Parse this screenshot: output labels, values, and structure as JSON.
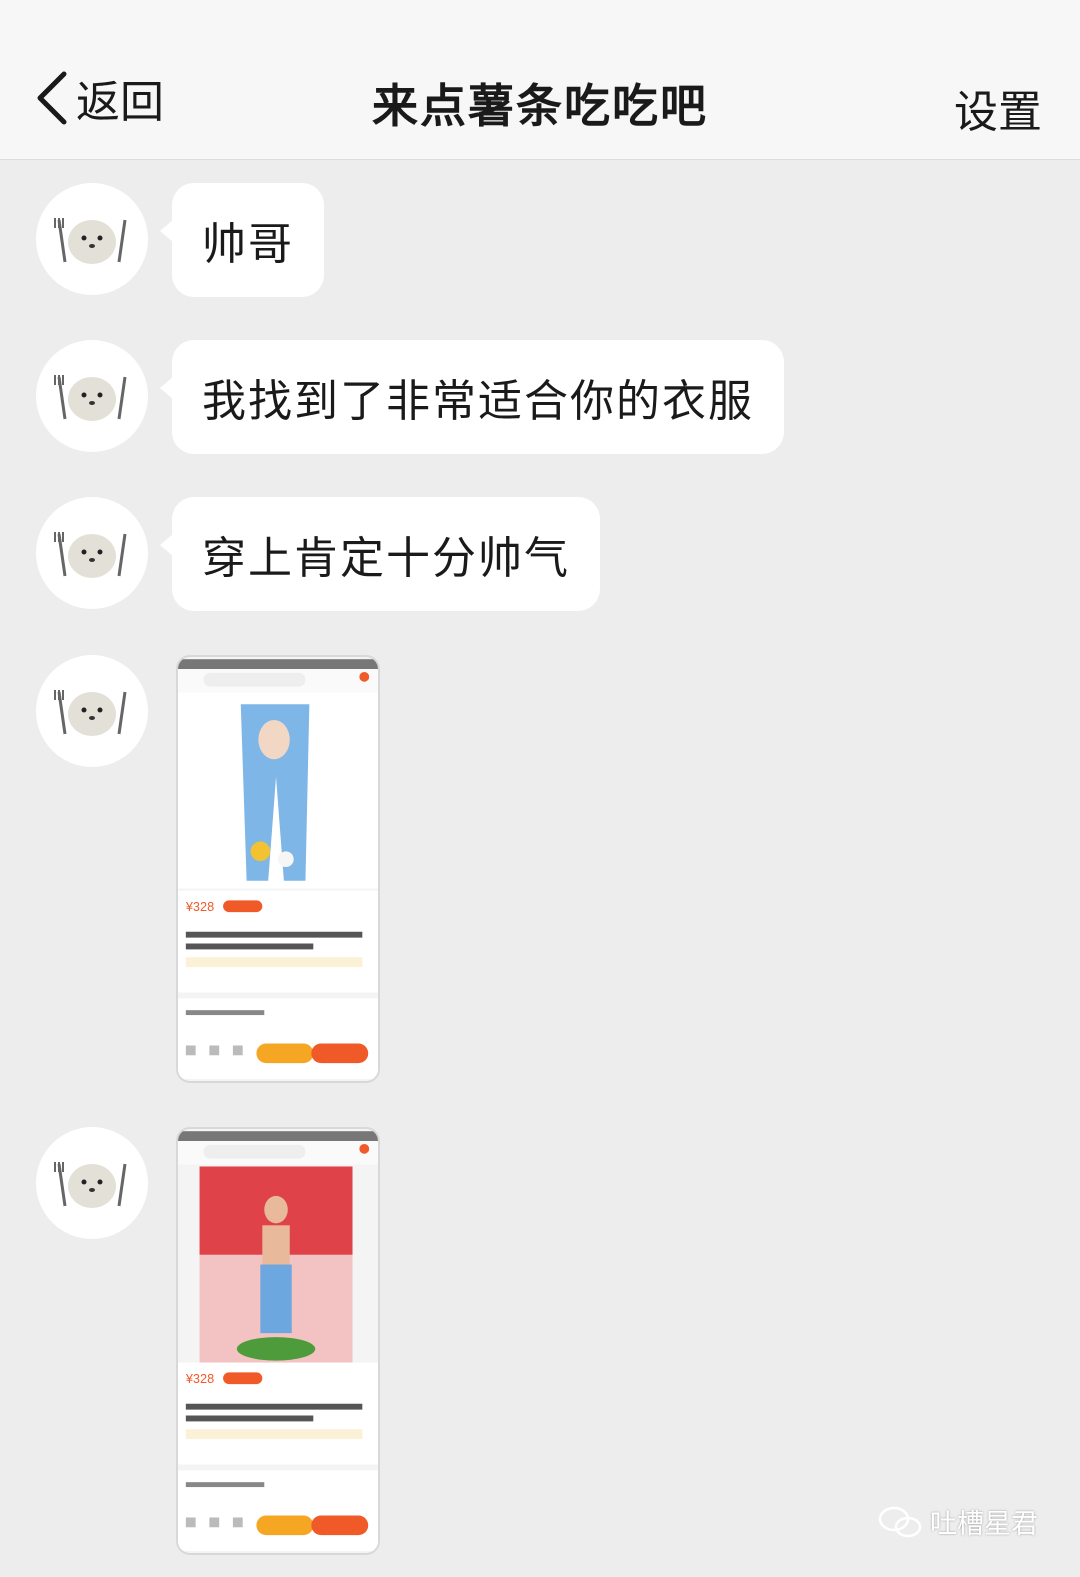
{
  "header": {
    "back_label": "返回",
    "title": "来点薯条吃吃吧",
    "settings_label": "设置"
  },
  "messages": [
    {
      "type": "text",
      "text": "帅哥"
    },
    {
      "type": "text",
      "text": "我找到了非常适合你的衣服"
    },
    {
      "type": "text",
      "text": "穿上肯定十分帅气"
    },
    {
      "type": "image",
      "product_price": "¥328"
    },
    {
      "type": "image",
      "product_price": "¥328"
    }
  ],
  "watermark": {
    "text": "吐槽星君"
  },
  "colors": {
    "background": "#ededed",
    "header": "#f7f7f7",
    "bubble": "#ffffff",
    "price_accent": "#f05a28",
    "button_orange": "#f5a623"
  }
}
